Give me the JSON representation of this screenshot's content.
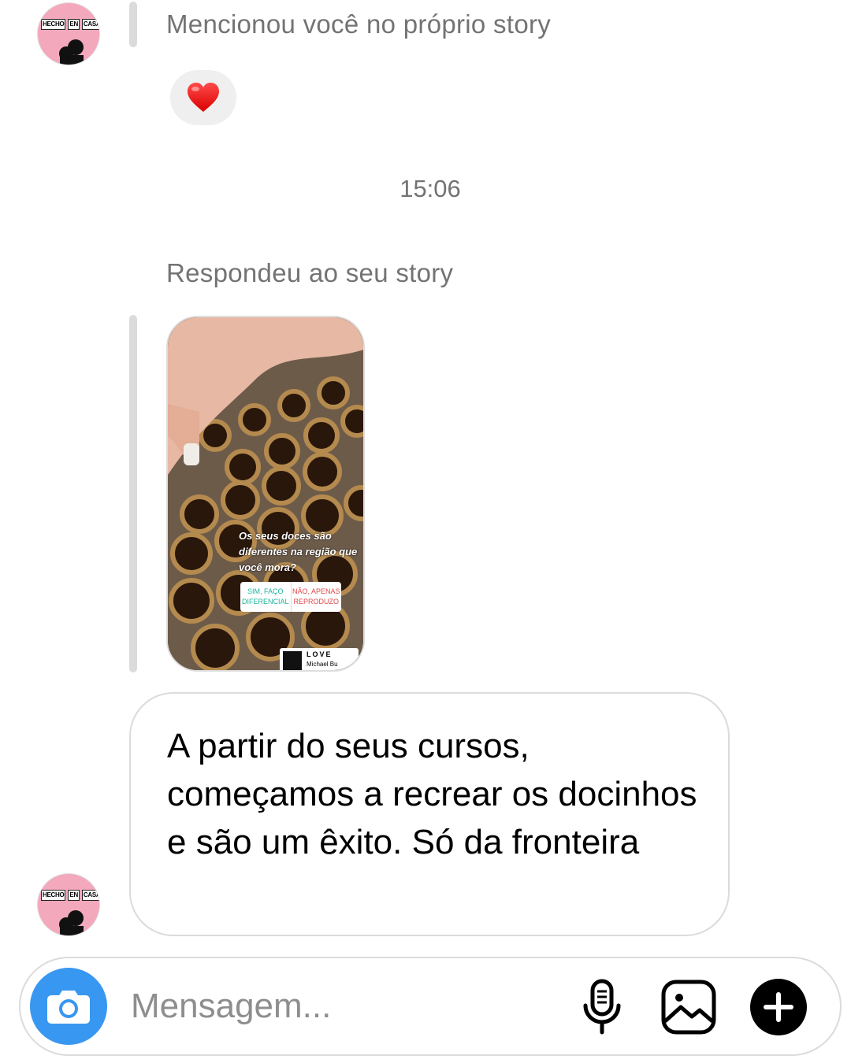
{
  "thread": {
    "mention_text": "Mencionou você no próprio story",
    "reaction": "❤️",
    "timestamp": "15:06",
    "reply_text": "Respondeu ao seu story",
    "story": {
      "question": "Os seus doces são diferentes na região que você mora?",
      "poll_option_1": "SIM, FAÇO DIFERENCIAL",
      "poll_option_2": "NÃO, APENAS REPRODUZO",
      "music_title": "LOVE",
      "music_artist": "Michael Bu"
    },
    "message_text": "A partir do seus cursos, começamos a recrear os docinhos e são um êxito. Só da fronteira",
    "avatar_sign": [
      "HECHO",
      "EN",
      "CASA"
    ]
  },
  "composer": {
    "placeholder": "Mensagem..."
  },
  "colors": {
    "accent_blue": "#3897f0",
    "meta_gray": "#737373",
    "bubble_border": "#dbdbdb"
  },
  "icons": [
    "camera-icon",
    "microphone-icon",
    "gallery-icon",
    "plus-icon",
    "heart-icon"
  ]
}
